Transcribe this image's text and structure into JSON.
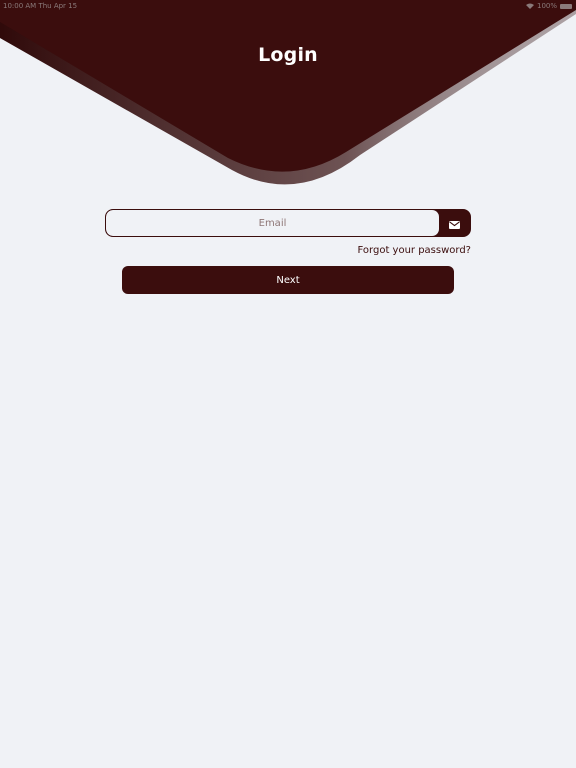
{
  "status_bar": {
    "time_date": "10:00 AM  Thu Apr 15",
    "battery_text": "100%"
  },
  "header": {
    "title": "Login"
  },
  "form": {
    "email_placeholder": "Email",
    "email_value": "",
    "email_icon": "envelope-icon",
    "forgot_label": "Forgot your password?",
    "next_label": "Next"
  },
  "colors": {
    "brand": "#3b0d0d",
    "background": "#f0f2f6",
    "text_light": "#ffffff"
  }
}
